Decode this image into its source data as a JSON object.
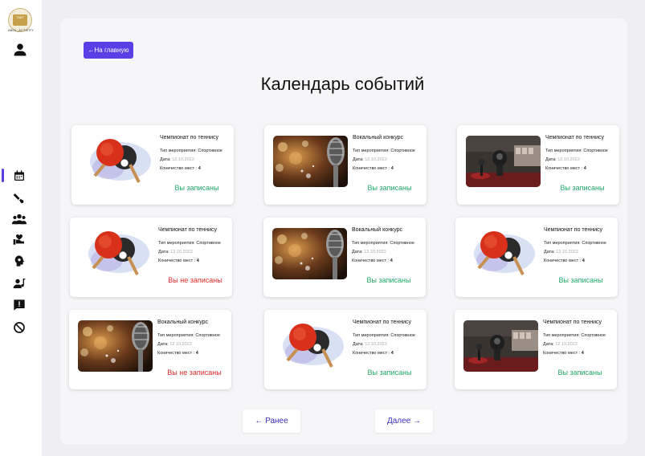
{
  "sidebar": {
    "logo_text": "ABOL_ACTIVITY",
    "logo_badge": "ТАКТ",
    "nav": [
      {
        "name": "calendar-icon"
      },
      {
        "name": "sports-icon"
      },
      {
        "name": "group-icon"
      },
      {
        "name": "volunteer-icon"
      },
      {
        "name": "brain-icon"
      },
      {
        "name": "music-user-icon"
      },
      {
        "name": "report-icon"
      },
      {
        "name": "block-icon"
      }
    ],
    "accent": "#5a3fe0"
  },
  "header": {
    "back_label": "←На главную",
    "title": "Календарь событий"
  },
  "cards": [
    {
      "title": "Чемпионат по теннису",
      "image": "table-tennis-image",
      "type_label": "Тип мероприятия:",
      "type_value": "Спортивное",
      "date_label": "Дата:",
      "date_value": "12.10.2022",
      "seats_label": "Коничество мест :",
      "seats_value": "4",
      "status": "Вы записаны",
      "status_kind": "ok"
    },
    {
      "title": "Вокальный конкурс",
      "image": "microphone-image",
      "type_label": "Тип мероприятия:",
      "type_value": "Спортивное",
      "date_label": "Дата:",
      "date_value": "12.10.2022",
      "seats_label": "Коничество мест :",
      "seats_value": "4",
      "status": "Вы записаны",
      "status_kind": "ok"
    },
    {
      "title": "Чемпионат по теннису",
      "image": "museum-image",
      "type_label": "Тип мероприятия:",
      "type_value": "Спортивное",
      "date_label": "Дата:",
      "date_value": "12.10.2022",
      "seats_label": "Коничество мест :",
      "seats_value": "4",
      "status": "Вы записаны",
      "status_kind": "ok"
    },
    {
      "title": "Чемпионат по теннису",
      "image": "table-tennis-image",
      "type_label": "Тип мероприятия:",
      "type_value": "Спортивное",
      "date_label": "Дата:",
      "date_value": "12.10.2022",
      "seats_label": "Коничество мест :",
      "seats_value": "4",
      "status": "Вы не записаны",
      "status_kind": "no"
    },
    {
      "title": "Вокальный конкурс",
      "image": "microphone-image",
      "type_label": "Тип мероприятия:",
      "type_value": "Спортивное",
      "date_label": "Дата:",
      "date_value": "12.10.2022",
      "seats_label": "Коничество мест :",
      "seats_value": "4",
      "status": "Вы записаны",
      "status_kind": "ok"
    },
    {
      "title": "Чемпионат по теннису",
      "image": "table-tennis-image",
      "type_label": "Тип мероприятия:",
      "type_value": "Спортивное",
      "date_label": "Дата:",
      "date_value": "12.10.2022",
      "seats_label": "Коничество мест :",
      "seats_value": "4",
      "status": "Вы записаны",
      "status_kind": "ok"
    },
    {
      "title": "Вокальный конкурс",
      "image": "microphone-image",
      "type_label": "Тип мероприятия:",
      "type_value": "Спортивное",
      "date_label": "Дата:",
      "date_value": "12.10.2022",
      "seats_label": "Коничество мест :",
      "seats_value": "4",
      "status": "Вы не записаны",
      "status_kind": "no"
    },
    {
      "title": "Чемпионат по теннису",
      "image": "table-tennis-image",
      "type_label": "Тип мероприятия:",
      "type_value": "Спортивное",
      "date_label": "Дата:",
      "date_value": "12.10.2022",
      "seats_label": "Коничество мест :",
      "seats_value": "4",
      "status": "Вы записаны",
      "status_kind": "ok"
    },
    {
      "title": "Чемпионат по теннису",
      "image": "museum-image",
      "type_label": "Тип мероприятия:",
      "type_value": "Спортивное",
      "date_label": "Дата:",
      "date_value": "12.10.2022",
      "seats_label": "Коничество мест :",
      "seats_value": "4",
      "status": "Вы записаны",
      "status_kind": "ok"
    }
  ],
  "pagination": {
    "prev_label": "← Ранее",
    "next_label": "Далее →"
  },
  "colors": {
    "status_ok": "#22a86a",
    "status_no": "#e02a2a",
    "primary": "#5b3fe6"
  }
}
